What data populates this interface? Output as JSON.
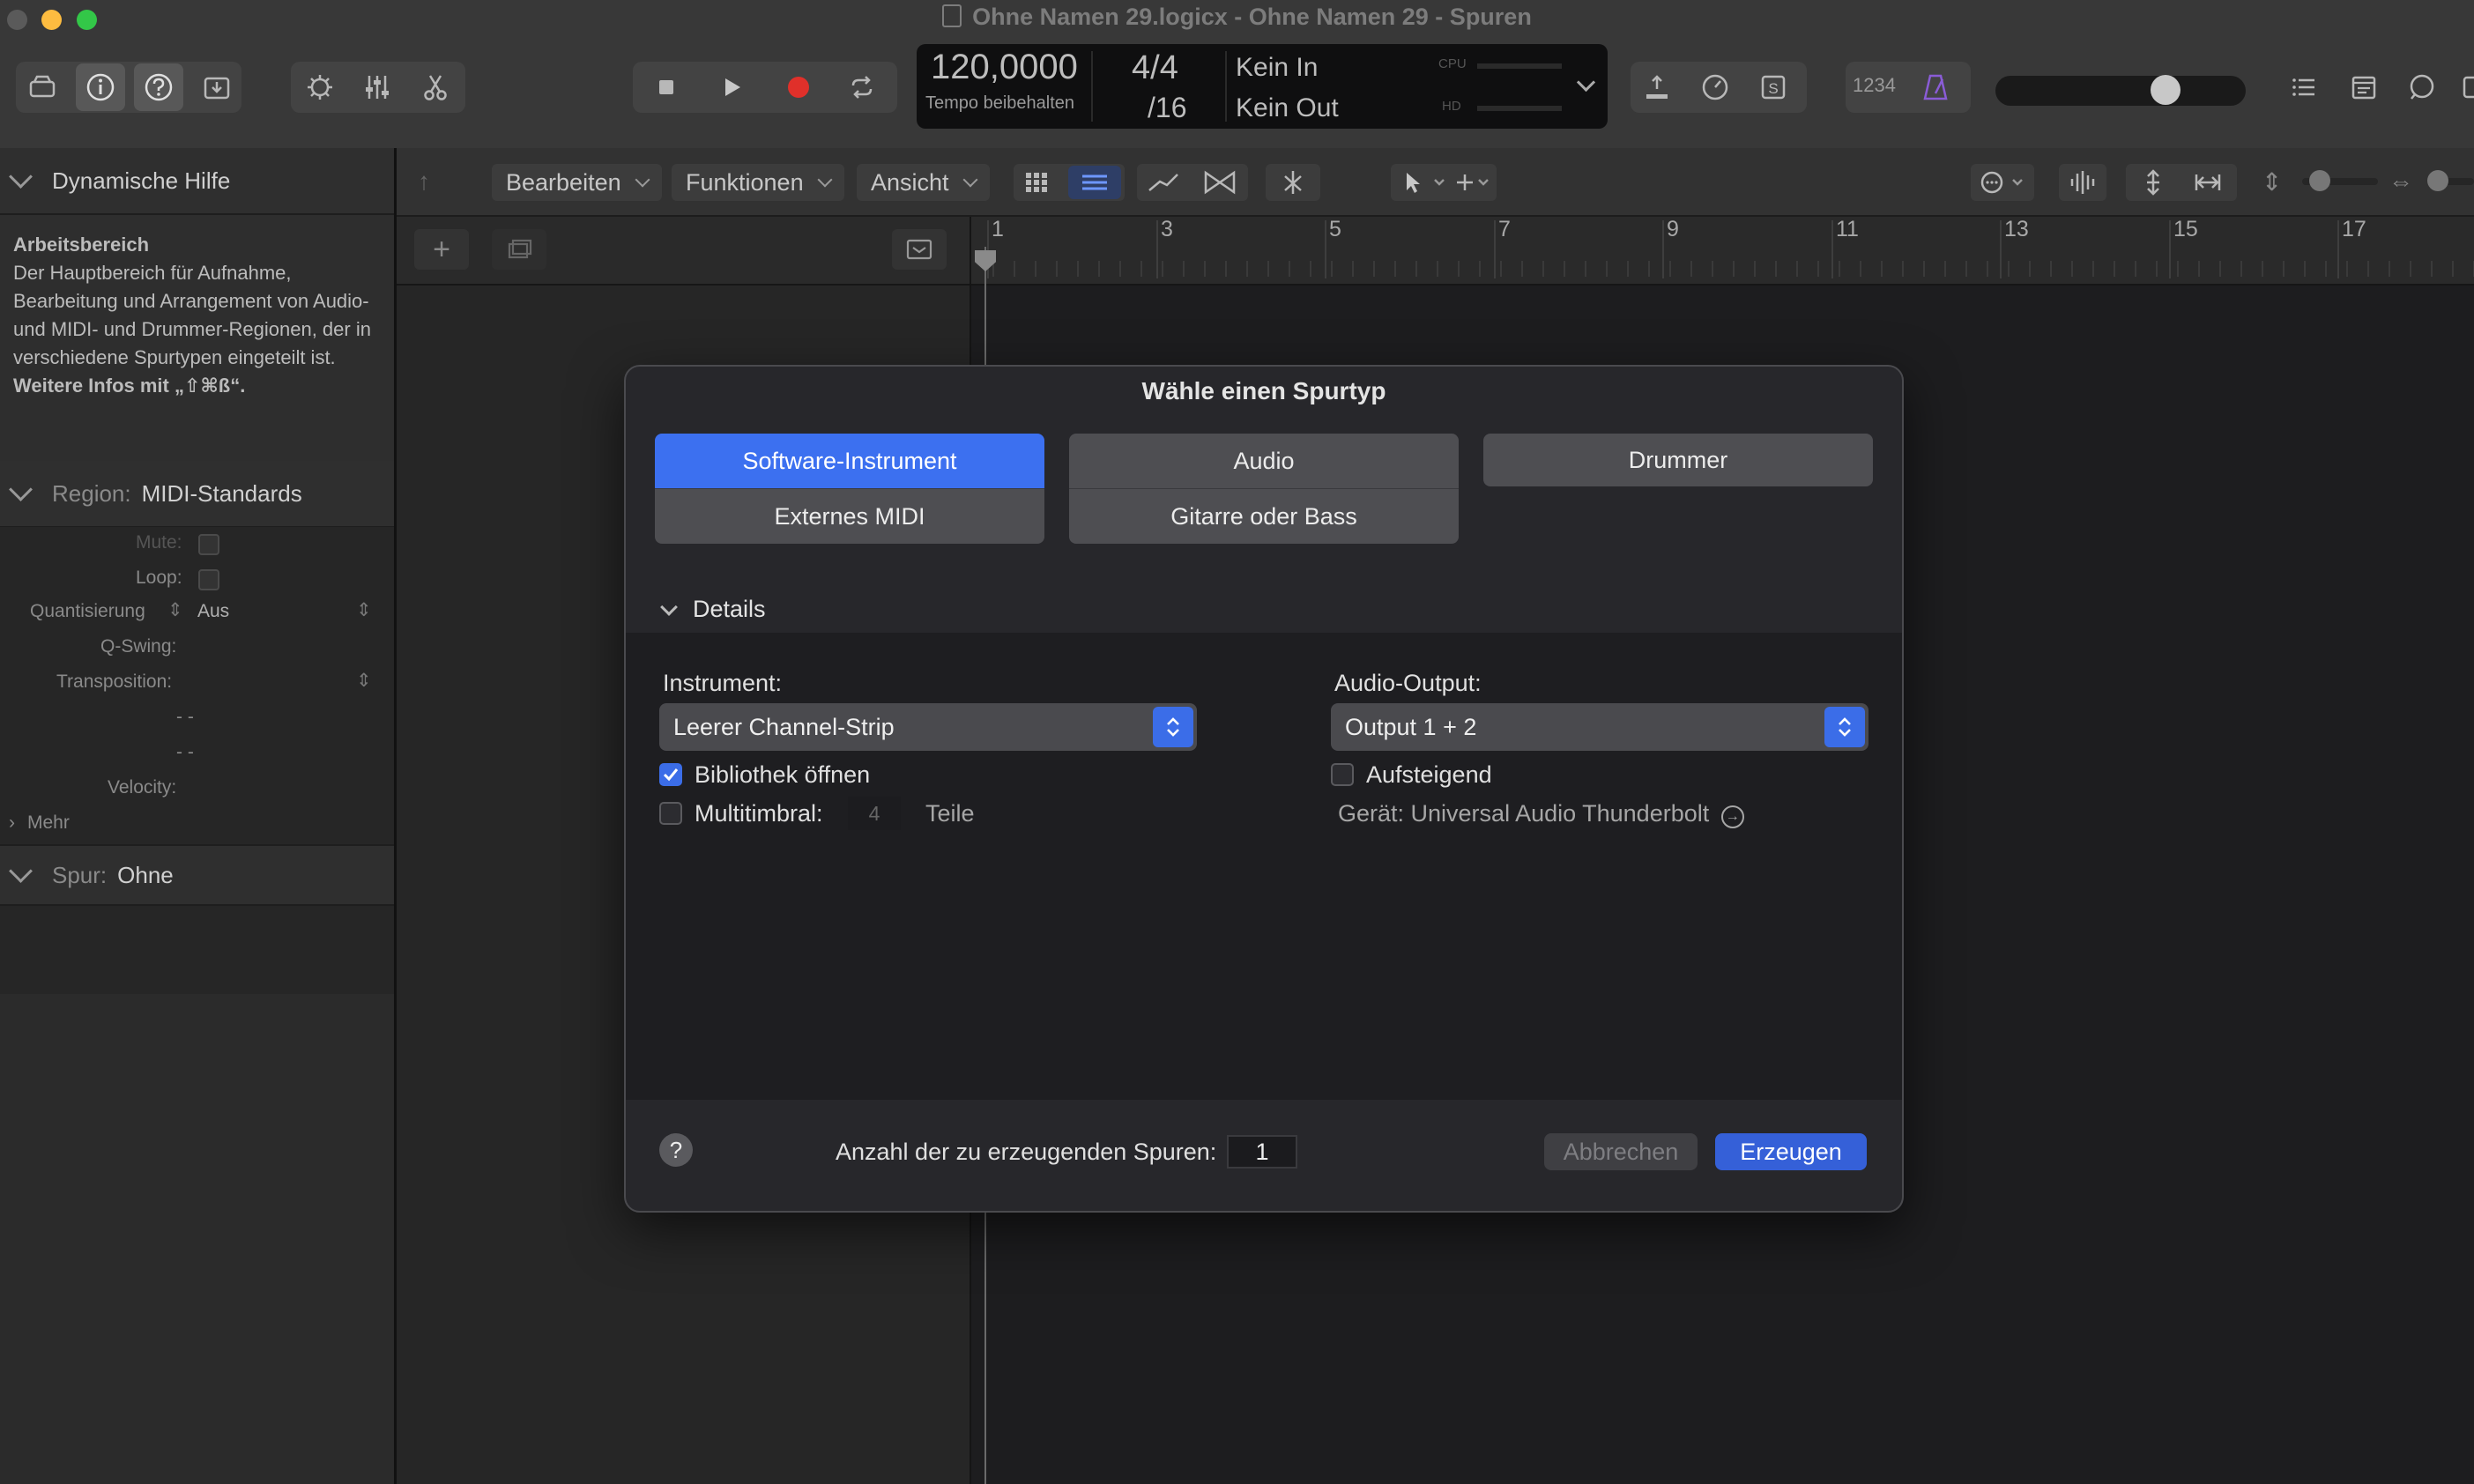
{
  "window": {
    "title": "Ohne Namen 29.logicx - Ohne Namen 29 - Spuren",
    "traffic_colors": [
      "#5a5a5a",
      "#fdbc40",
      "#33c748"
    ]
  },
  "lcd": {
    "tempo": "120,0000",
    "tempo_mode": "Tempo beibehalten",
    "signature": "4/4",
    "division": "/16",
    "in": "Kein In",
    "out": "Kein Out",
    "cpu_label": "CPU",
    "hd_label": "HD"
  },
  "toolbar": {
    "count_in": "1234"
  },
  "inspector": {
    "help_header": "Dynamische Hilfe",
    "help_title": "Arbeitsbereich",
    "help_text": "Der Hauptbereich für Aufnahme, Bearbeitung und Arrangement von Audio- und MIDI- und Drummer-Regionen, der in verschiedene Spurtypen eingeteilt ist.",
    "help_more": "Weitere Infos mit „⇧⌘ß“.",
    "region_label": "Region:",
    "region_name": "MIDI-Standards",
    "mute_label": "Mute:",
    "loop_label": "Loop:",
    "quant_label": "Quantisierung",
    "quant_value": "Aus",
    "qswing_label": "Q-Swing:",
    "transpose_label": "Transposition:",
    "dash1": "- -",
    "dash2": "- -",
    "velocity_label": "Velocity:",
    "more_label": "Mehr",
    "track_label": "Spur:",
    "track_name": "Ohne"
  },
  "localbar": {
    "edit": "Bearbeiten",
    "functions": "Funktionen",
    "view": "Ansicht"
  },
  "ruler": {
    "bars": [
      "1",
      "3",
      "5",
      "7",
      "9",
      "11",
      "13",
      "15",
      "17"
    ]
  },
  "dialog": {
    "title": "Wähle einen Spurtyp",
    "types": {
      "software_instrument": "Software-Instrument",
      "external_midi": "Externes MIDI",
      "audio": "Audio",
      "guitar_bass": "Gitarre oder Bass",
      "drummer": "Drummer"
    },
    "details_label": "Details",
    "instrument_label": "Instrument:",
    "instrument_value": "Leerer Channel-Strip",
    "library_label": "Bibliothek öffnen",
    "library_checked": true,
    "multitimbral_label": "Multitimbral:",
    "multitimbral_checked": false,
    "parts_value": "4",
    "parts_label": "Teile",
    "output_label": "Audio-Output:",
    "output_value": "Output 1 + 2",
    "ascending_label": "Aufsteigend",
    "ascending_checked": false,
    "device_text": "Gerät: Universal Audio Thunderbolt",
    "help_glyph": "?",
    "count_label": "Anzahl der zu erzeugenden Spuren:",
    "count_value": "1",
    "cancel_label": "Abbrechen",
    "create_label": "Erzeugen",
    "accent_color": "#3c70f0"
  }
}
